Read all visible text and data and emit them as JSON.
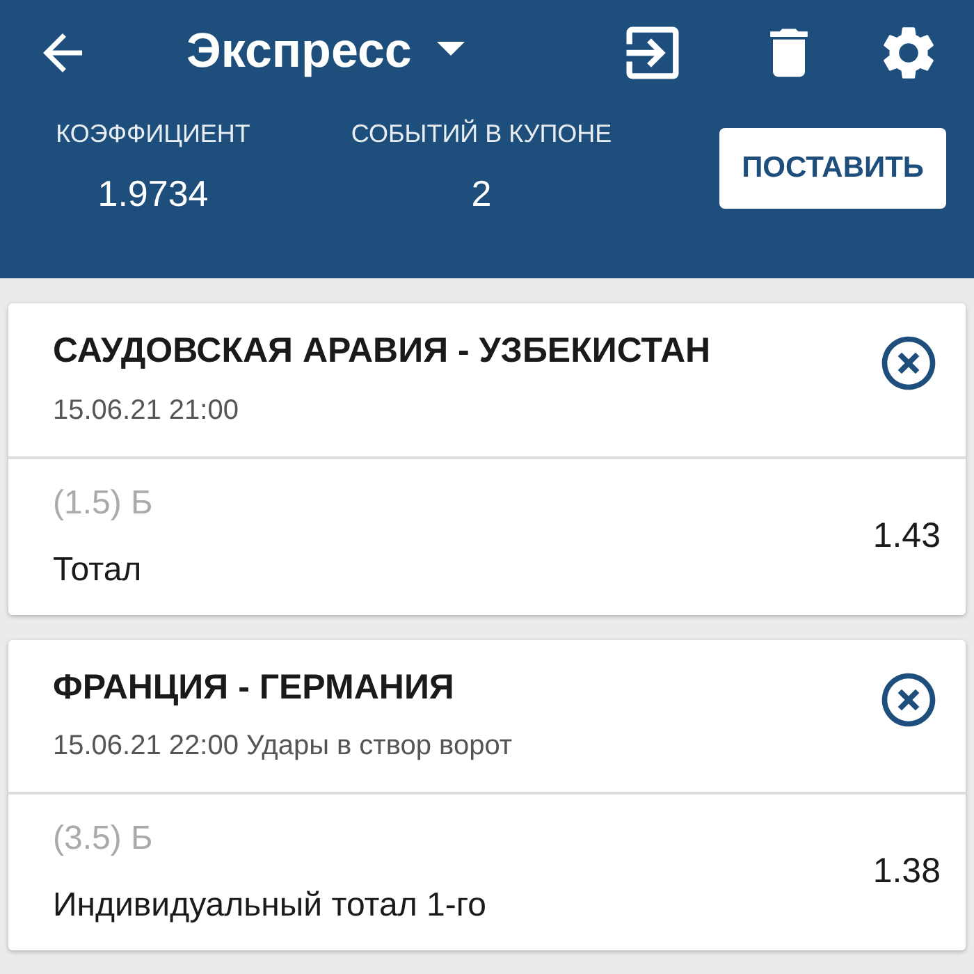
{
  "header": {
    "title": "Экспресс"
  },
  "summary": [
    {
      "label": "КОЭФФИЦИЕНТ",
      "value": "1.9734"
    },
    {
      "label": "СОБЫТИЙ В КУПОНЕ",
      "value": "2"
    }
  ],
  "place_button": "ПОСТАВИТЬ",
  "bets": [
    {
      "match": "САУДОВСКАЯ АРАВИЯ - УЗБЕКИСТАН",
      "info": "15.06.21 21:00",
      "outcome": "(1.5) Б",
      "market": "Тотал",
      "odds": "1.43"
    },
    {
      "match": "ФРАНЦИЯ - ГЕРМАНИЯ",
      "info": "15.06.21 22:00 Удары в створ ворот",
      "outcome": "(3.5) Б",
      "market": "Индивидуальный тотал 1-го",
      "odds": "1.38"
    }
  ]
}
